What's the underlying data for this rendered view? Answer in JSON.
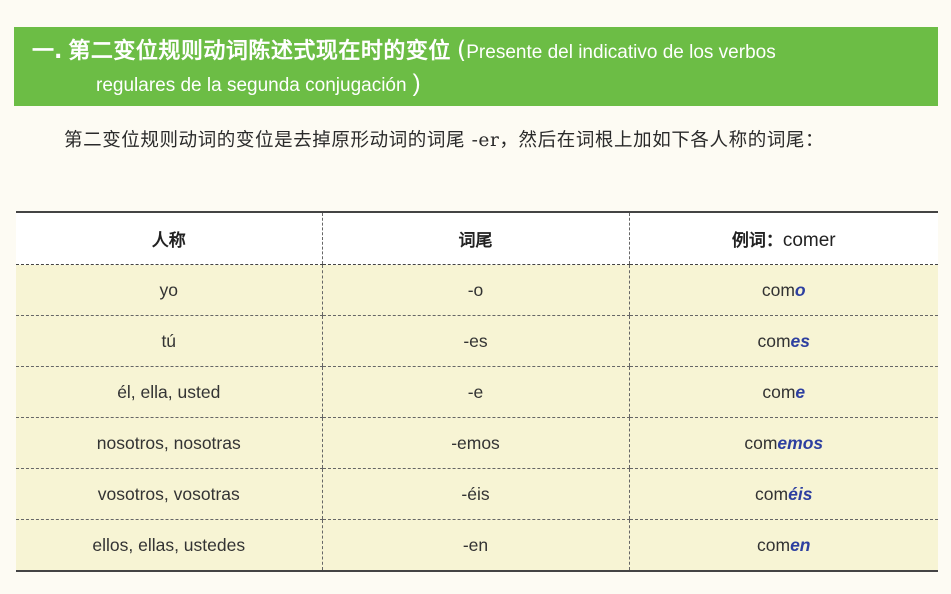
{
  "header": {
    "number": "一.",
    "title_cn": "第二变位规则动词陈述式现在时的变位",
    "open_paren": "(",
    "title_es_line1": "Presente del indicativo de los verbos",
    "title_es_line2": "regulares de la segunda conjugación",
    "close_paren": ")"
  },
  "intro": {
    "text": "第二变位规则动词的变位是去掉原形动词的词尾 -er，然后在词根上加如下各人称的词尾："
  },
  "table": {
    "headers": {
      "person": "人称",
      "ending": "词尾",
      "example_label": "例词：",
      "example_verb": "comer"
    },
    "rows": [
      {
        "person": "yo",
        "ending": "-o",
        "stem": "com",
        "suffix": "o"
      },
      {
        "person": "tú",
        "ending": "-es",
        "stem": "com",
        "suffix": "es"
      },
      {
        "person": "él, ella, usted",
        "ending": "-e",
        "stem": "com",
        "suffix": "e"
      },
      {
        "person": "nosotros, nosotras",
        "ending": "-emos",
        "stem": "com",
        "suffix": "emos"
      },
      {
        "person": "vosotros, vosotras",
        "ending": "-éis",
        "stem": "com",
        "suffix": "éis"
      },
      {
        "person": "ellos, ellas, ustedes",
        "ending": "-en",
        "stem": "com",
        "suffix": "en"
      }
    ]
  },
  "colors": {
    "header_bg": "#6cbd45",
    "header_text": "#ffffff",
    "row_bg": "#f7f4d4",
    "ending_highlight": "#2d3fa0"
  }
}
